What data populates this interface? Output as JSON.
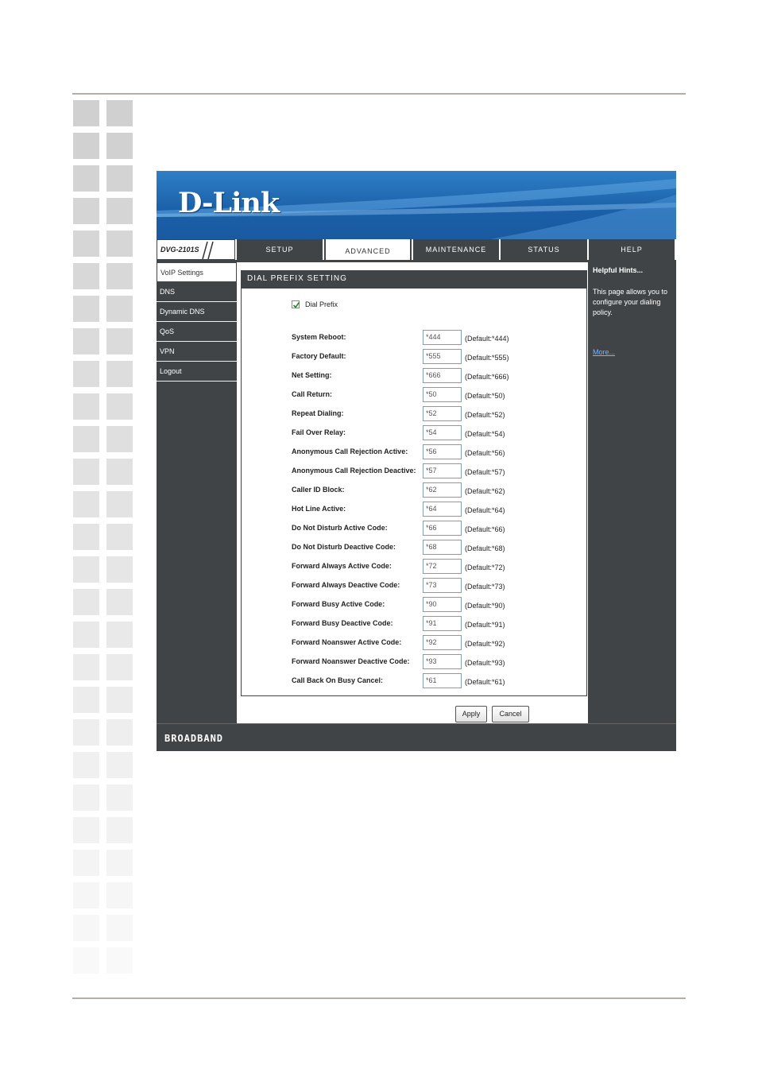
{
  "brand": {
    "logo_text": "D-Link",
    "model": "DVG-2101S",
    "footer": "BROADBAND"
  },
  "nav": {
    "tabs": [
      {
        "label": "SETUP"
      },
      {
        "label": "ADVANCED",
        "active": true
      },
      {
        "label": "MAINTENANCE"
      },
      {
        "label": "STATUS"
      },
      {
        "label": "HELP"
      }
    ]
  },
  "sidebar": {
    "items": [
      {
        "label": "VoIP Settings",
        "active": true
      },
      {
        "label": "DNS"
      },
      {
        "label": "Dynamic DNS"
      },
      {
        "label": "QoS"
      },
      {
        "label": "VPN"
      },
      {
        "label": "Logout"
      }
    ]
  },
  "form": {
    "title": "DIAL PREFIX SETTING",
    "dial_prefix": {
      "label": "Dial Prefix",
      "checked": true
    },
    "rows": [
      {
        "label": "System Reboot:",
        "value": "*444",
        "default": "(Default:*444)"
      },
      {
        "label": "Factory Default:",
        "value": "*555",
        "default": "(Default:*555)"
      },
      {
        "label": "Net Setting:",
        "value": "*666",
        "default": "(Default:*666)"
      },
      {
        "label": "Call Return:",
        "value": "*50",
        "default": "(Default:*50)"
      },
      {
        "label": "Repeat Dialing:",
        "value": "*52",
        "default": "(Default:*52)"
      },
      {
        "label": "Fail Over Relay:",
        "value": "*54",
        "default": "(Default:*54)"
      },
      {
        "label": "Anonymous Call Rejection Active:",
        "value": "*56",
        "default": "(Default:*56)"
      },
      {
        "label": "Anonymous Call Rejection Deactive:",
        "value": "*57",
        "default": "(Default:*57)"
      },
      {
        "label": "Caller ID Block:",
        "value": "*62",
        "default": "(Default:*62)"
      },
      {
        "label": "Hot Line Active:",
        "value": "*64",
        "default": "(Default:*64)"
      },
      {
        "label": "Do Not Disturb Active Code:",
        "value": "*66",
        "default": "(Default:*66)"
      },
      {
        "label": "Do Not Disturb Deactive Code:",
        "value": "*68",
        "default": "(Default:*68)"
      },
      {
        "label": "Forward Always Active Code:",
        "value": "*72",
        "default": "(Default:*72)"
      },
      {
        "label": "Forward Always Deactive Code:",
        "value": "*73",
        "default": "(Default:*73)"
      },
      {
        "label": "Forward Busy Active Code:",
        "value": "*90",
        "default": "(Default:*90)"
      },
      {
        "label": "Forward Busy Deactive Code:",
        "value": "*91",
        "default": "(Default:*91)"
      },
      {
        "label": "Forward Noanswer Active Code:",
        "value": "*92",
        "default": "(Default:*92)"
      },
      {
        "label": "Forward Noanswer Deactive Code:",
        "value": "*93",
        "default": "(Default:*93)"
      },
      {
        "label": "Call Back On Busy Cancel:",
        "value": "*61",
        "default": "(Default:*61)"
      }
    ],
    "apply_label": "Apply",
    "cancel_label": "Cancel"
  },
  "hints": {
    "title": "Helpful Hints...",
    "text": "This page allows you to configure your dialing policy.",
    "more": "More..."
  },
  "colors": {
    "panel": "#404447",
    "banner": "#1a5fa8",
    "link": "#7fb0ff"
  }
}
